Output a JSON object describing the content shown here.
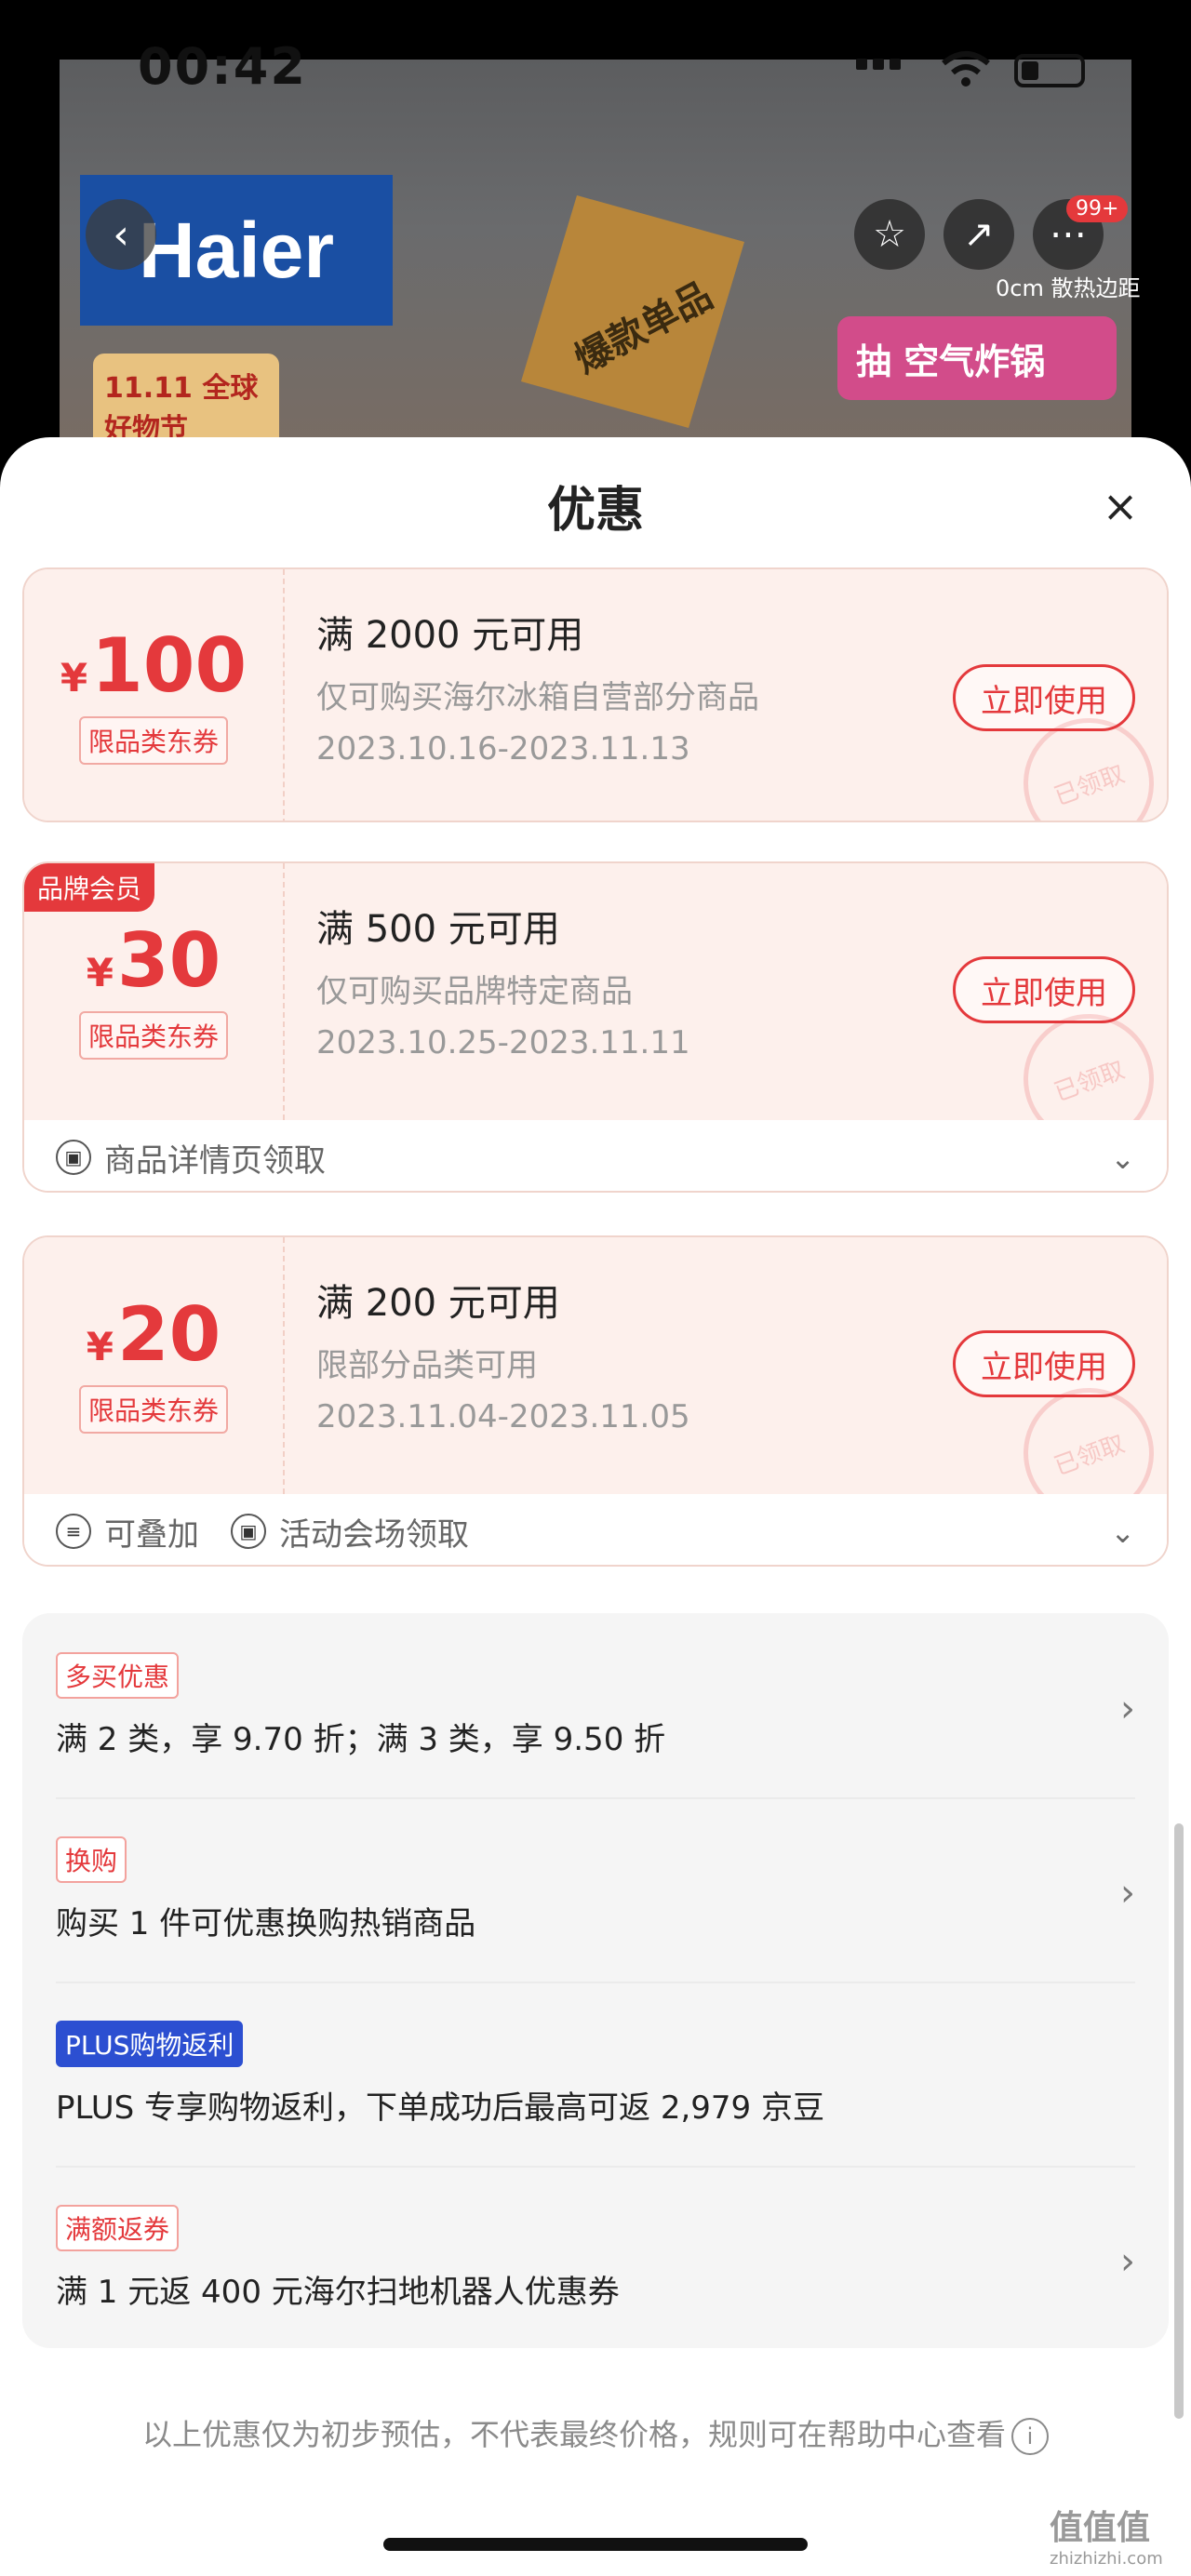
{
  "status_bar": {
    "time": "00:42"
  },
  "background": {
    "brand": "Haier",
    "no1_badge": "爆款单品",
    "event_label": "11.11 全球好物节",
    "distance_label": "0cm 散热边距",
    "fryer_promo": "抽 空气炸锅",
    "cart_badge": "99+"
  },
  "sheet": {
    "title": "优惠",
    "close_icon": "close-icon"
  },
  "coupons": [
    {
      "amount": "100",
      "currency": "¥",
      "type": "限品类东券",
      "condition": "满 2000 元可用",
      "scope": "仅可购买海尔冰箱自营部分商品",
      "date": "2023.10.16-2023.11.13",
      "button": "立即使用",
      "stamp": "已领取"
    },
    {
      "amount": "30",
      "currency": "¥",
      "type": "限品类东券",
      "member_tag": "品牌会员",
      "condition": "满 500 元可用",
      "scope": "仅可购买品牌特定商品",
      "date": "2023.10.25-2023.11.11",
      "button": "立即使用",
      "stamp": "已领取",
      "source": "商品详情页领取"
    },
    {
      "amount": "20",
      "currency": "¥",
      "type": "限品类东券",
      "condition": "满 200 元可用",
      "scope": "限部分品类可用",
      "date": "2023.11.04-2023.11.05",
      "button": "立即使用",
      "stamp": "已领取",
      "stackable": "可叠加",
      "source": "活动会场领取"
    }
  ],
  "promotions": [
    {
      "tag": "多买优惠",
      "desc": "满 2 类，享 9.70 折；满 3 类，享 9.50 折",
      "has_arrow": true
    },
    {
      "tag": "换购",
      "desc": "购买 1 件可优惠换购热销商品",
      "has_arrow": true
    },
    {
      "tag": "PLUS购物返利",
      "desc": "PLUS 专享购物返利，下单成功后最高可返 2,979 京豆",
      "has_arrow": false
    },
    {
      "tag": "满额返券",
      "desc": "满 1 元返 400 元海尔扫地机器人优惠券",
      "has_arrow": true
    }
  ],
  "footer": {
    "note": "以上优惠仅为初步预估，不代表最终价格，规则可在帮助中心查看"
  },
  "watermark": {
    "text": "值值值",
    "url": "zhizhizhi.com"
  },
  "colors": {
    "accent": "#e4393c",
    "plus": "#2c4fd1",
    "coupon_bg": "#fdf0ec"
  }
}
